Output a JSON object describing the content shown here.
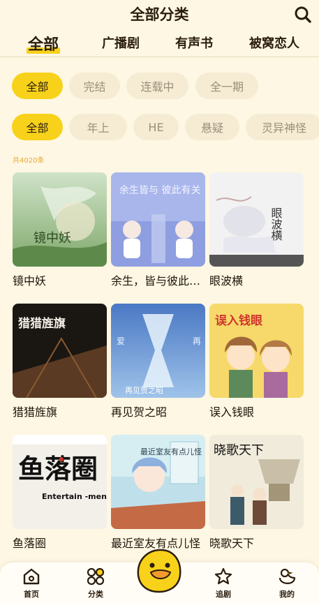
{
  "header": {
    "title": "全部分类"
  },
  "tabs": [
    {
      "label": "全部",
      "active": true
    },
    {
      "label": "广播剧",
      "active": false
    },
    {
      "label": "有声书",
      "active": false
    },
    {
      "label": "被窝恋人",
      "active": false
    }
  ],
  "filters_status": [
    {
      "label": "全部",
      "active": true
    },
    {
      "label": "完结",
      "active": false
    },
    {
      "label": "连载中",
      "active": false
    },
    {
      "label": "全一期",
      "active": false
    }
  ],
  "filters_genre": [
    {
      "label": "全部",
      "active": true
    },
    {
      "label": "年上",
      "active": false
    },
    {
      "label": "HE",
      "active": false
    },
    {
      "label": "悬疑",
      "active": false
    },
    {
      "label": "灵异神怪",
      "active": false
    }
  ],
  "result_count": "共4020条",
  "items": [
    {
      "title": "镜中妖",
      "cover_text": "镜中妖"
    },
    {
      "title": "余生，皆与彼此有关",
      "cover_text": "余生皆与 彼此有关"
    },
    {
      "title": "眼波横",
      "cover_text": "眼波横"
    },
    {
      "title": "猎猎旌旗",
      "cover_text": "猎猎旌旗"
    },
    {
      "title": "再见贺之昭",
      "cover_text": "再见贺之昭"
    },
    {
      "title": "误入钱眼",
      "cover_text": "误入钱眼"
    },
    {
      "title": "鱼落圈",
      "cover_text": "鱼落圈"
    },
    {
      "title": "最近室友有点儿怪",
      "cover_text": "最近室友有点儿怪"
    },
    {
      "title": "晓歌天下",
      "cover_text": "晓歌天下"
    }
  ],
  "cover_subtext": {
    "c2_left": "爱",
    "c2_right": "再",
    "c3_en": "Entertain -ment circle"
  },
  "bottom_nav": [
    {
      "label": "首页",
      "icon": "home-icon"
    },
    {
      "label": "分类",
      "icon": "category-icon"
    },
    {
      "label": "追剧",
      "icon": "star-icon"
    },
    {
      "label": "我的",
      "icon": "duck-icon"
    }
  ],
  "colors": {
    "accent": "#f8d21a",
    "background": "#fdf7e3",
    "chip": "#f6ecd4"
  }
}
